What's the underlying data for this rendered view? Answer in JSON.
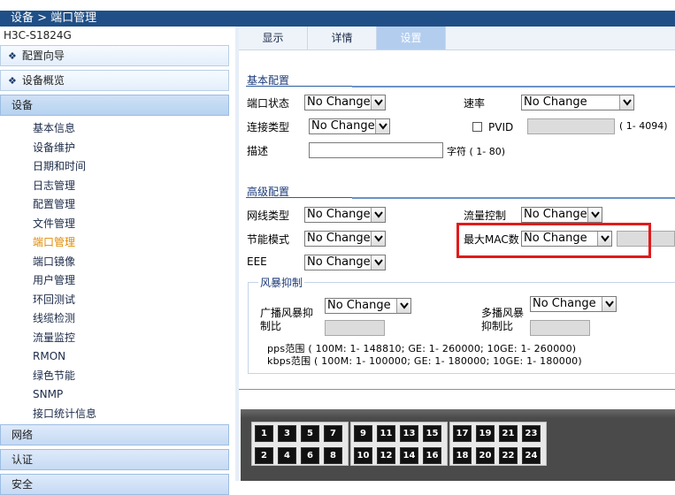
{
  "breadcrumb": "设备 > 端口管理",
  "device_name": "H3C-S1824G",
  "sidebar": {
    "wizard": "配置向导",
    "overview": "设备概览",
    "device": "设备",
    "items": [
      {
        "label": "基本信息"
      },
      {
        "label": "设备维护"
      },
      {
        "label": "日期和时间"
      },
      {
        "label": "日志管理"
      },
      {
        "label": "配置管理"
      },
      {
        "label": "文件管理"
      },
      {
        "label": "端口管理",
        "active": true
      },
      {
        "label": "端口镜像"
      },
      {
        "label": "用户管理"
      },
      {
        "label": "环回测试"
      },
      {
        "label": "线缆检测"
      },
      {
        "label": "流量监控"
      },
      {
        "label": "RMON"
      },
      {
        "label": "绿色节能"
      },
      {
        "label": "SNMP"
      },
      {
        "label": "接口统计信息"
      }
    ],
    "network": "网络",
    "auth": "认证",
    "security_partial": "安全"
  },
  "tabs": [
    {
      "label": "显示"
    },
    {
      "label": "详情"
    },
    {
      "label": "设置",
      "active": true
    }
  ],
  "basic": {
    "title": "基本配置",
    "port_status_label": "端口状态",
    "port_status_value": "No Change",
    "speed_label": "速率",
    "speed_value": "No Change",
    "link_type_label": "连接类型",
    "link_type_value": "No Change",
    "pvid_label": "PVID",
    "pvid_range": "( 1- 4094)",
    "desc_label": "描述",
    "desc_hint": "字符 ( 1- 80)"
  },
  "advanced": {
    "title": "高级配置",
    "mdi_label": "网线类型",
    "mdi_value": "No Change",
    "flow_label": "流量控制",
    "flow_value": "No Change",
    "power_label": "节能模式",
    "power_value": "No Change",
    "mac_label": "最大MAC数",
    "mac_value": "No Change",
    "eee_label": "EEE",
    "eee_value": "No Change"
  },
  "storm": {
    "legend": "风暴抑制",
    "broadcast_label_1": "广播风暴抑",
    "broadcast_label_2": "制比",
    "broadcast_value": "No Change",
    "multicast_label_1": "多播风暴",
    "multicast_label_2": "抑制比",
    "multicast_value": "No Change",
    "pps_range": "pps范围 ( 100M: 1- 148810; GE: 1- 260000; 10GE: 1- 260000)",
    "kbps_range": "kbps范围 ( 100M: 1- 100000; GE: 1- 180000; 10GE: 1- 180000)"
  },
  "ports": {
    "groups": [
      {
        "top": [
          "1",
          "3",
          "5",
          "7"
        ],
        "bottom": [
          "2",
          "4",
          "6",
          "8"
        ]
      },
      {
        "top": [
          "9",
          "11",
          "13",
          "15"
        ],
        "bottom": [
          "10",
          "12",
          "14",
          "16"
        ]
      },
      {
        "top": [
          "17",
          "19",
          "21",
          "23"
        ],
        "bottom": [
          "18",
          "20",
          "22",
          "24"
        ]
      }
    ]
  },
  "colors": {
    "title_bar": "#1f4f86",
    "active_tab": "#b3cdee",
    "active_menu": "#e08a00",
    "highlight": "#e01b1b"
  }
}
